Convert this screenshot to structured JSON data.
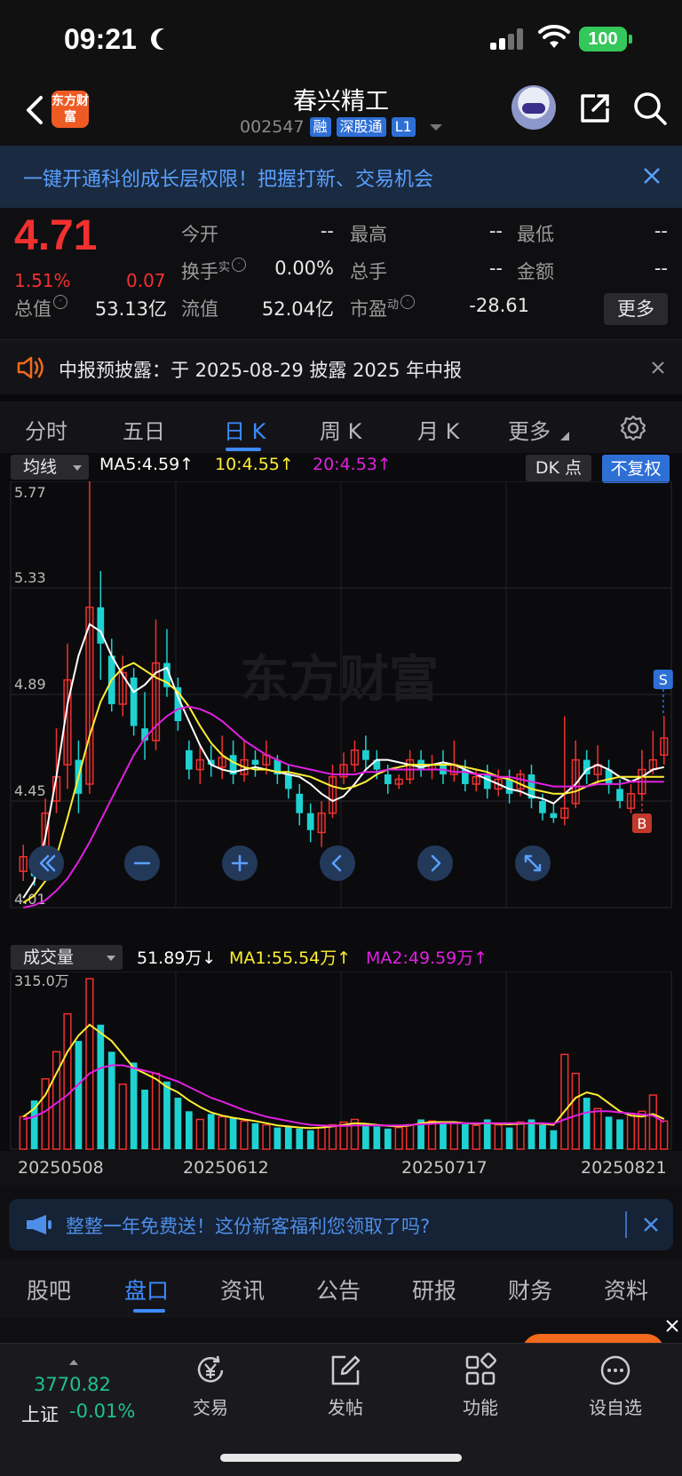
{
  "status": {
    "time": "09:21",
    "battery": "100"
  },
  "header": {
    "logo": "东方财富",
    "stock_name": "春兴精工",
    "code": "002547",
    "tags": [
      "融",
      "深股通",
      "L1"
    ]
  },
  "promo": {
    "text": "一键开通科创成长层权限！把握打新、交易机会"
  },
  "quote": {
    "price": "4.71",
    "pct": "1.51%",
    "change": "0.07",
    "open_label": "今开",
    "open_value": "--",
    "high_label": "最高",
    "high_value": "--",
    "low_label": "最低",
    "low_value": "--",
    "turnover_label": "换手",
    "turnover_sup": "实",
    "turnover_value": "0.00%",
    "volume_label": "总手",
    "volume_value": "--",
    "amount_label": "金额",
    "amount_value": "--",
    "mcap_label": "总值",
    "mcap_value": "53.13亿",
    "float_label": "流值",
    "float_value": "52.04亿",
    "pe_label": "市盈",
    "pe_sup": "动",
    "pe_value": "-28.61",
    "more_label": "更多"
  },
  "notice": {
    "text": "中报预披露：于 2025-08-29 披露 2025 年中报"
  },
  "chart_tabs": [
    "分时",
    "五日",
    "日 K",
    "周 K",
    "月 K",
    "更多"
  ],
  "indicator": {
    "dropdown": "均线",
    "ma5": "MA5:4.59↑",
    "ma10": "10:4.55↑",
    "ma20": "20:4.53↑",
    "dk_label": "DK 点",
    "fq_label": "不复权",
    "y_ticks": [
      "5.77",
      "5.33",
      "4.89",
      "4.45",
      "4.01"
    ],
    "s_marker": "S",
    "b_marker": "B",
    "watermark": "东方财富"
  },
  "volume": {
    "dropdown": "成交量",
    "current": "51.89万↓",
    "ma1": "MA1:55.54万↑",
    "ma2": "MA2:49.59万↑",
    "y_max": "315.0万"
  },
  "dates": [
    "20250508",
    "20250612",
    "20250717",
    "20250821"
  ],
  "colors": {
    "up": "#f23030",
    "down": "#1ed2d2",
    "ma5": "#ffffff",
    "ma10": "#ffee33",
    "ma20": "#e020e0",
    "accent": "#3d8bff"
  },
  "chart_data": {
    "type": "candlestick",
    "ylim": [
      4.01,
      5.77
    ],
    "y_ticks": [
      5.77,
      5.33,
      4.89,
      4.45,
      4.01
    ],
    "x_ticks": [
      "20250508",
      "20250612",
      "20250717",
      "20250821"
    ],
    "series": [
      {
        "name": "MA5",
        "values": [
          4.05,
          4.12,
          4.3,
          4.55,
          4.85,
          5.05,
          5.18,
          5.15,
          5.05,
          4.97,
          4.9,
          4.93,
          4.98,
          5.0,
          4.88,
          4.78,
          4.68,
          4.6,
          4.58,
          4.57,
          4.58,
          4.59,
          4.58,
          4.57,
          4.56,
          4.55,
          4.52,
          4.48,
          4.45,
          4.47,
          4.52,
          4.58,
          4.62,
          4.62,
          4.61,
          4.6,
          4.59,
          4.6,
          4.61,
          4.6,
          4.58,
          4.56,
          4.54,
          4.52,
          4.5,
          4.49,
          4.47,
          4.46,
          4.44,
          4.48,
          4.52,
          4.58,
          4.6,
          4.58,
          4.55,
          4.53,
          4.55,
          4.58,
          4.59
        ]
      },
      {
        "name": "MA10",
        "values": [
          4.03,
          4.06,
          4.12,
          4.22,
          4.38,
          4.55,
          4.72,
          4.86,
          4.95,
          5.0,
          5.02,
          4.99,
          4.96,
          4.94,
          4.9,
          4.84,
          4.76,
          4.69,
          4.64,
          4.61,
          4.59,
          4.58,
          4.58,
          4.57,
          4.57,
          4.56,
          4.55,
          4.53,
          4.51,
          4.5,
          4.51,
          4.53,
          4.56,
          4.58,
          4.59,
          4.6,
          4.6,
          4.6,
          4.6,
          4.6,
          4.59,
          4.58,
          4.57,
          4.55,
          4.54,
          4.52,
          4.5,
          4.49,
          4.48,
          4.48,
          4.49,
          4.51,
          4.53,
          4.54,
          4.55,
          4.55,
          4.55,
          4.55,
          4.55
        ]
      },
      {
        "name": "MA20",
        "values": [
          4.01,
          4.02,
          4.04,
          4.08,
          4.13,
          4.2,
          4.28,
          4.37,
          4.46,
          4.55,
          4.64,
          4.71,
          4.76,
          4.8,
          4.83,
          4.84,
          4.83,
          4.81,
          4.78,
          4.74,
          4.7,
          4.67,
          4.64,
          4.62,
          4.6,
          4.59,
          4.58,
          4.57,
          4.56,
          4.56,
          4.56,
          4.57,
          4.57,
          4.58,
          4.58,
          4.58,
          4.58,
          4.58,
          4.58,
          4.57,
          4.57,
          4.56,
          4.56,
          4.55,
          4.55,
          4.54,
          4.53,
          4.52,
          4.51,
          4.51,
          4.51,
          4.51,
          4.52,
          4.52,
          4.52,
          4.53,
          4.53,
          4.53,
          4.53
        ]
      }
    ],
    "candles": [
      {
        "o": 4.16,
        "c": 4.22,
        "h": 4.27,
        "l": 4.12
      },
      {
        "o": 4.21,
        "c": 4.14,
        "h": 4.24,
        "l": 4.1
      },
      {
        "o": 4.14,
        "c": 4.4,
        "h": 4.46,
        "l": 4.12
      },
      {
        "o": 4.45,
        "c": 4.55,
        "h": 4.75,
        "l": 4.4
      },
      {
        "o": 4.6,
        "c": 4.95,
        "h": 5.1,
        "l": 4.5
      },
      {
        "o": 4.62,
        "c": 4.48,
        "h": 4.7,
        "l": 4.4
      },
      {
        "o": 4.52,
        "c": 5.25,
        "h": 5.77,
        "l": 4.48
      },
      {
        "o": 5.25,
        "c": 5.1,
        "h": 5.4,
        "l": 4.95
      },
      {
        "o": 5.05,
        "c": 4.85,
        "h": 5.12,
        "l": 4.82
      },
      {
        "o": 4.85,
        "c": 4.98,
        "h": 5.05,
        "l": 4.8
      },
      {
        "o": 4.96,
        "c": 4.76,
        "h": 5.0,
        "l": 4.72
      },
      {
        "o": 4.75,
        "c": 4.7,
        "h": 4.9,
        "l": 4.62
      },
      {
        "o": 4.7,
        "c": 5.02,
        "h": 5.2,
        "l": 4.66
      },
      {
        "o": 5.02,
        "c": 4.92,
        "h": 5.16,
        "l": 4.88
      },
      {
        "o": 4.92,
        "c": 4.78,
        "h": 4.96,
        "l": 4.74
      },
      {
        "o": 4.66,
        "c": 4.58,
        "h": 4.7,
        "l": 4.54
      },
      {
        "o": 4.58,
        "c": 4.62,
        "h": 4.68,
        "l": 4.52
      },
      {
        "o": 4.62,
        "c": 4.6,
        "h": 4.68,
        "l": 4.55
      },
      {
        "o": 4.59,
        "c": 4.63,
        "h": 4.72,
        "l": 4.54
      },
      {
        "o": 4.64,
        "c": 4.56,
        "h": 4.7,
        "l": 4.52
      },
      {
        "o": 4.56,
        "c": 4.62,
        "h": 4.7,
        "l": 4.53
      },
      {
        "o": 4.62,
        "c": 4.6,
        "h": 4.66,
        "l": 4.55
      },
      {
        "o": 4.6,
        "c": 4.64,
        "h": 4.7,
        "l": 4.56
      },
      {
        "o": 4.62,
        "c": 4.56,
        "h": 4.64,
        "l": 4.52
      },
      {
        "o": 4.56,
        "c": 4.5,
        "h": 4.6,
        "l": 4.46
      },
      {
        "o": 4.48,
        "c": 4.4,
        "h": 4.52,
        "l": 4.35
      },
      {
        "o": 4.4,
        "c": 4.33,
        "h": 4.44,
        "l": 4.28
      },
      {
        "o": 4.32,
        "c": 4.4,
        "h": 4.45,
        "l": 4.26
      },
      {
        "o": 4.4,
        "c": 4.55,
        "h": 4.6,
        "l": 4.38
      },
      {
        "o": 4.55,
        "c": 4.6,
        "h": 4.65,
        "l": 4.52
      },
      {
        "o": 4.6,
        "c": 4.66,
        "h": 4.7,
        "l": 4.57
      },
      {
        "o": 4.66,
        "c": 4.62,
        "h": 4.72,
        "l": 4.58
      },
      {
        "o": 4.62,
        "c": 4.58,
        "h": 4.66,
        "l": 4.54
      },
      {
        "o": 4.56,
        "c": 4.52,
        "h": 4.6,
        "l": 4.48
      },
      {
        "o": 4.52,
        "c": 4.54,
        "h": 4.56,
        "l": 4.5
      },
      {
        "o": 4.54,
        "c": 4.62,
        "h": 4.66,
        "l": 4.52
      },
      {
        "o": 4.62,
        "c": 4.58,
        "h": 4.66,
        "l": 4.55
      },
      {
        "o": 4.58,
        "c": 4.6,
        "h": 4.64,
        "l": 4.54
      },
      {
        "o": 4.6,
        "c": 4.56,
        "h": 4.66,
        "l": 4.52
      },
      {
        "o": 4.56,
        "c": 4.6,
        "h": 4.7,
        "l": 4.53
      },
      {
        "o": 4.58,
        "c": 4.52,
        "h": 4.62,
        "l": 4.49
      },
      {
        "o": 4.52,
        "c": 4.55,
        "h": 4.58,
        "l": 4.49
      },
      {
        "o": 4.56,
        "c": 4.5,
        "h": 4.6,
        "l": 4.46
      },
      {
        "o": 4.5,
        "c": 4.54,
        "h": 4.58,
        "l": 4.47
      },
      {
        "o": 4.54,
        "c": 4.48,
        "h": 4.58,
        "l": 4.44
      },
      {
        "o": 4.5,
        "c": 4.56,
        "h": 4.58,
        "l": 4.47
      },
      {
        "o": 4.56,
        "c": 4.46,
        "h": 4.6,
        "l": 4.42
      },
      {
        "o": 4.45,
        "c": 4.4,
        "h": 4.48,
        "l": 4.37
      },
      {
        "o": 4.4,
        "c": 4.38,
        "h": 4.44,
        "l": 4.36
      },
      {
        "o": 4.38,
        "c": 4.42,
        "h": 4.8,
        "l": 4.35
      },
      {
        "o": 4.44,
        "c": 4.62,
        "h": 4.7,
        "l": 4.42
      },
      {
        "o": 4.62,
        "c": 4.56,
        "h": 4.66,
        "l": 4.52
      },
      {
        "o": 4.56,
        "c": 4.6,
        "h": 4.68,
        "l": 4.52
      },
      {
        "o": 4.58,
        "c": 4.52,
        "h": 4.62,
        "l": 4.48
      },
      {
        "o": 4.5,
        "c": 4.45,
        "h": 4.54,
        "l": 4.42
      },
      {
        "o": 4.42,
        "c": 4.48,
        "h": 4.52,
        "l": 4.4
      },
      {
        "o": 4.48,
        "c": 4.58,
        "h": 4.66,
        "l": 4.46
      },
      {
        "o": 4.58,
        "c": 4.62,
        "h": 4.74,
        "l": 4.56
      },
      {
        "o": 4.64,
        "c": 4.71,
        "h": 4.8,
        "l": 4.6
      }
    ],
    "volume": {
      "ylim": [
        0,
        315.0
      ],
      "unit": "万",
      "values": [
        60,
        90,
        130,
        180,
        250,
        200,
        315,
        230,
        180,
        120,
        160,
        110,
        140,
        125,
        95,
        70,
        55,
        65,
        60,
        58,
        52,
        48,
        45,
        40,
        42,
        38,
        35,
        40,
        45,
        50,
        55,
        48,
        42,
        38,
        40,
        45,
        55,
        52,
        48,
        50,
        46,
        44,
        55,
        45,
        40,
        50,
        55,
        45,
        35,
        175,
        140,
        95,
        75,
        60,
        55,
        65,
        70,
        100,
        52
      ],
      "ma1": [
        60,
        75,
        100,
        140,
        180,
        210,
        230,
        215,
        200,
        175,
        150,
        140,
        130,
        115,
        105,
        90,
        78,
        68,
        62,
        58,
        55,
        52,
        48,
        44,
        42,
        40,
        39,
        40,
        42,
        45,
        48,
        47,
        45,
        43,
        42,
        44,
        48,
        50,
        50,
        50,
        48,
        47,
        48,
        47,
        46,
        47,
        48,
        47,
        45,
        70,
        95,
        105,
        100,
        85,
        70,
        62,
        60,
        65,
        56
      ],
      "ma2": [
        55,
        60,
        70,
        85,
        100,
        120,
        140,
        150,
        155,
        155,
        150,
        145,
        140,
        132,
        125,
        115,
        105,
        95,
        88,
        80,
        72,
        66,
        60,
        56,
        52,
        48,
        45,
        44,
        43,
        43,
        44,
        44,
        44,
        44,
        44,
        45,
        46,
        47,
        48,
        48,
        48,
        48,
        48,
        48,
        48,
        48,
        48,
        48,
        47,
        55,
        62,
        68,
        70,
        70,
        68,
        66,
        64,
        62,
        50
      ]
    }
  },
  "bottom_promo": {
    "text": "整整一年免费送！这份新客福利您领取了吗?"
  },
  "bottom_tabs": [
    "股吧",
    "盘口",
    "资讯",
    "公告",
    "研报",
    "财务",
    "资料"
  ],
  "footer": {
    "index_value": "3770.82",
    "index_name": "上证",
    "index_change": "-0.01%",
    "nav": [
      "交易",
      "发帖",
      "功能",
      "设自选"
    ]
  }
}
